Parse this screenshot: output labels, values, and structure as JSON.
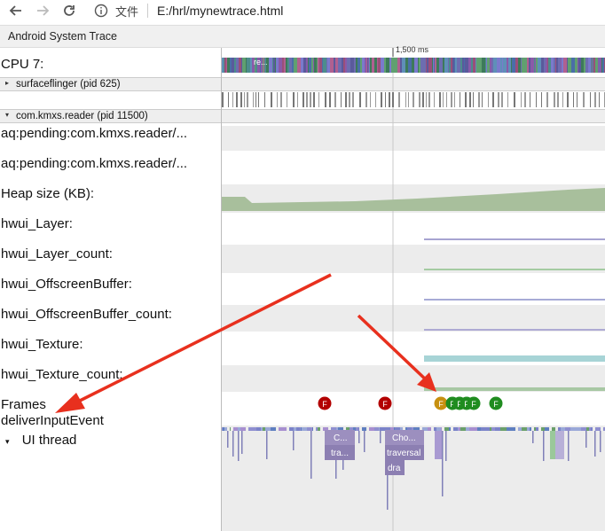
{
  "browser": {
    "back_icon": "arrow-left-icon",
    "forward_icon": "arrow-right-icon",
    "reload_icon": "reload-icon",
    "info_icon": "info-icon",
    "file_label": "文件",
    "url": "E:/hrl/mynewtrace.html"
  },
  "app": {
    "title": "Android System Trace"
  },
  "timeline": {
    "tick_label": "1,500 ms"
  },
  "cpu": {
    "label": "CPU 7:",
    "slice_label": "re..."
  },
  "processes": [
    {
      "caret": "▸",
      "name": "surfaceflinger (pid 625)"
    },
    {
      "caret": "▾",
      "name": "com.kmxs.reader (pid 11500)"
    }
  ],
  "tracks": [
    "aq:pending:com.kmxs.reader/...",
    "aq:pending:com.kmxs.reader/...",
    "Heap size (KB):",
    "hwui_Layer:",
    "hwui_Layer_count:",
    "hwui_OffscreenBuffer:",
    "hwui_OffscreenBuffer_count:",
    "hwui_Texture:",
    "hwui_Texture_count:"
  ],
  "frames": {
    "label": "Frames",
    "marker": "F"
  },
  "deliver": {
    "label": "deliverInputEvent"
  },
  "ui_thread": {
    "caret": "▾",
    "label": "UI thread"
  },
  "slices": {
    "s1": "C...",
    "s2": "tra...",
    "s3": "Cho...",
    "s4": "traversal",
    "s5": "dra"
  },
  "colors": {
    "annotation_arrow": "#e8301e",
    "frame_red": "#b30000",
    "frame_orange": "#c79010",
    "frame_green": "#1f8c1f",
    "heap_fill": "#a8bf9c",
    "slice_purple": "#9c8fbf"
  }
}
